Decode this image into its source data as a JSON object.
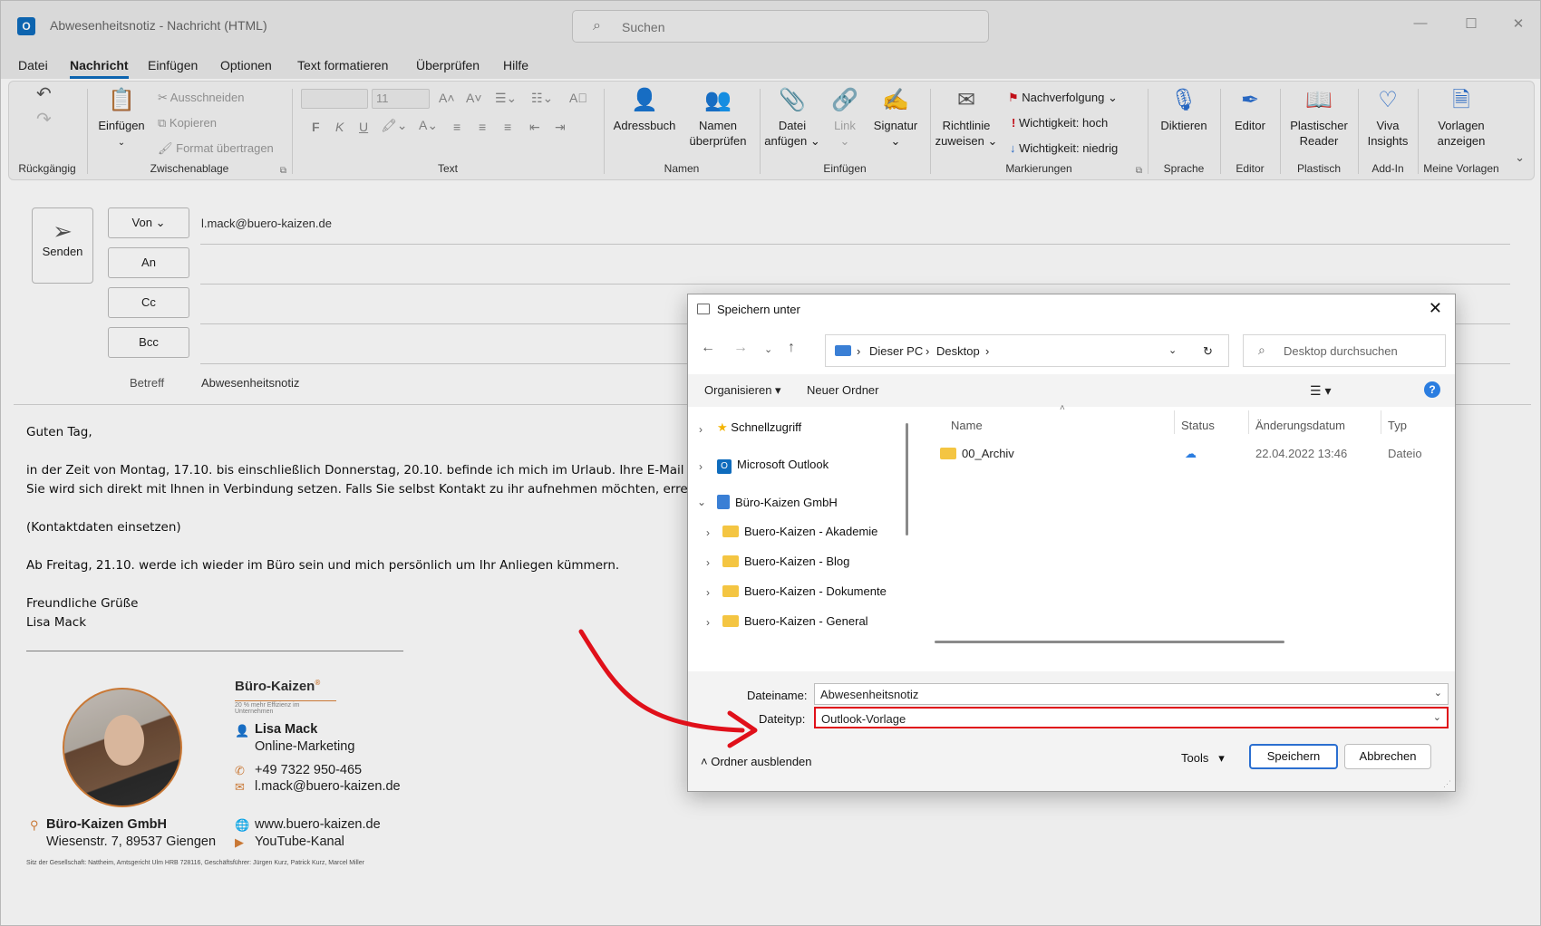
{
  "window": {
    "title": "Abwesenheitsnotiz  -  Nachricht (HTML)",
    "search_placeholder": "Suchen",
    "minimize": "—",
    "maximize": "☐",
    "close": "✕"
  },
  "menu": [
    "Datei",
    "Nachricht",
    "Einfügen",
    "Optionen",
    "Text formatieren",
    "Überprüfen",
    "Hilfe"
  ],
  "ribbon": {
    "undo_group": "Rückgängig",
    "clipboard": {
      "paste": "Einfügen",
      "cut": "Ausschneiden",
      "copy": "Kopieren",
      "format": "Format übertragen",
      "label": "Zwischenablage"
    },
    "text": {
      "font_size": "11",
      "bold": "F",
      "italic": "K",
      "underline": "U",
      "label": "Text"
    },
    "names": {
      "address_book": "Adressbuch",
      "check_names_1": "Namen",
      "check_names_2": "überprüfen",
      "label": "Namen"
    },
    "insert": {
      "attach_1": "Datei",
      "attach_2": "anfügen",
      "link": "Link",
      "signature": "Signatur",
      "label": "Einfügen"
    },
    "tags": {
      "policy_1": "Richtlinie",
      "policy_2": "zuweisen",
      "followup": "Nachverfolgung",
      "high": "Wichtigkeit: hoch",
      "low": "Wichtigkeit: niedrig",
      "label": "Markierungen"
    },
    "voice": {
      "dictate": "Diktieren",
      "label": "Sprache"
    },
    "editor": {
      "editor": "Editor",
      "label": "Editor"
    },
    "immersive": {
      "reader_1": "Plastischer",
      "reader_2": "Reader",
      "label": "Plastisch"
    },
    "addin": {
      "viva_1": "Viva",
      "viva_2": "Insights",
      "label": "Add-In"
    },
    "templates": {
      "view_1": "Vorlagen",
      "view_2": "anzeigen",
      "label": "Meine Vorlagen"
    }
  },
  "compose": {
    "send": "Senden",
    "from_btn": "Von",
    "from_value": "l.mack@buero-kaizen.de",
    "to_btn": "An",
    "cc_btn": "Cc",
    "bcc_btn": "Bcc",
    "subject_label": "Betreff",
    "subject_value": "Abwesenheitsnotiz",
    "body": {
      "greeting": "Guten Tag,",
      "line1": "in der Zeit von Montag, 17.10. bis einschließlich Donnerstag, 20.10. befinde ich mich im Urlaub. Ihre E-Mail wi",
      "line2": "Sie wird sich direkt mit Ihnen in Verbindung setzen. Falls Sie selbst Kontakt zu ihr aufnehmen möchten, erreich",
      "contact": "(Kontaktdaten einsetzen)",
      "return": "Ab Freitag, 21.10. werde ich wieder im Büro sein und mich persönlich um Ihr Anliegen kümmern.",
      "closing": "Freundliche Grüße",
      "name": "Lisa Mack"
    },
    "signature": {
      "brand": "Büro-Kaizen",
      "brand_reg": "®",
      "tagline": "20 % mehr Effizienz im Unternehmen",
      "name": "Lisa Mack",
      "role": "Online-Marketing",
      "phone": "+49 7322 950-465",
      "email": "l.mack@buero-kaizen.de",
      "company": "Büro-Kaizen GmbH",
      "address": "Wiesenstr. 7, 89537 Giengen",
      "web": "www.buero-kaizen.de",
      "youtube": "YouTube-Kanal",
      "legal": "Sitz der Gesellschaft: Nattheim, Amtsgericht Ulm HRB 728116, Geschäftsführer: Jürgen Kurz, Patrick Kurz, Marcel Miller"
    }
  },
  "dialog": {
    "title": "Speichern unter",
    "path": [
      "Dieser PC",
      "Desktop"
    ],
    "search_placeholder": "Desktop durchsuchen",
    "organize": "Organisieren",
    "new_folder": "Neuer Ordner",
    "tree": [
      "Schnellzugriff",
      "Microsoft Outlook",
      "Büro-Kaizen GmbH",
      "Buero-Kaizen - Akademie",
      "Buero-Kaizen - Blog",
      "Buero-Kaizen - Dokumente",
      "Buero-Kaizen - General"
    ],
    "columns": [
      "Name",
      "Status",
      "Änderungsdatum",
      "Typ"
    ],
    "files": [
      {
        "name": "00_Archiv",
        "date": "22.04.2022 13:46",
        "type": "Dateio"
      }
    ],
    "filename_label": "Dateiname:",
    "filename_value": "Abwesenheitsnotiz",
    "filetype_label": "Dateityp:",
    "filetype_value": "Outlook-Vorlage",
    "hide_folders": "Ordner ausblenden",
    "tools": "Tools",
    "save": "Speichern",
    "cancel": "Abbrechen"
  },
  "colors": {
    "accent": "#0f6cbd",
    "highlight": "#e0101a",
    "signature_orange": "#d9823a"
  }
}
